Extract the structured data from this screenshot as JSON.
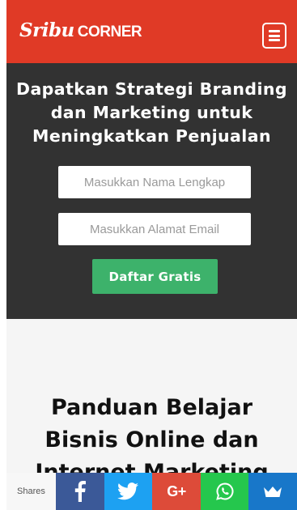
{
  "header": {
    "logo_main": "Sribu",
    "logo_sub": "CORNER",
    "accent_color": "#e03a26",
    "menu_icon": "hamburger-menu-icon"
  },
  "hero": {
    "background_color": "#323232",
    "title": "Dapatkan Strategi Branding dan Marketing untuk Meningkatkan Penjualan",
    "name_field": {
      "value": "",
      "placeholder": "Masukkan Nama Lengkap"
    },
    "email_field": {
      "value": "",
      "placeholder": "Masukkan Alamat Email"
    },
    "submit_label": "Daftar Gratis",
    "submit_color": "#3db26b"
  },
  "article": {
    "title": "Panduan Belajar\nBisnis Online dan\nInternet Marketing"
  },
  "share_bar": {
    "label": "Shares",
    "buttons": [
      {
        "icon": "facebook-icon",
        "color": "#3b5998"
      },
      {
        "icon": "twitter-icon",
        "color": "#1da1f2"
      },
      {
        "icon": "google-plus-icon",
        "text": "G+",
        "color": "#dd4b39"
      },
      {
        "icon": "whatsapp-icon",
        "color": "#25c74d"
      },
      {
        "icon": "sumo-crown-icon",
        "color": "#1877c9"
      }
    ]
  }
}
